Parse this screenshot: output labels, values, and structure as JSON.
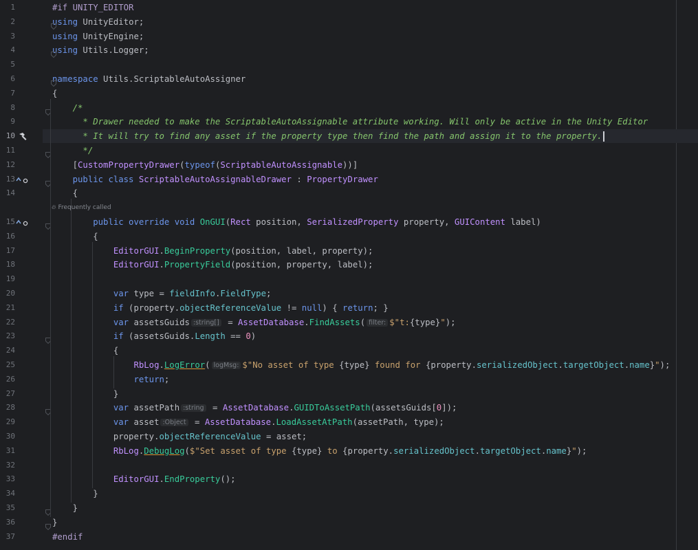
{
  "editor": {
    "code_vision_hint": "Frequently called",
    "lines": [
      {
        "n": "1",
        "parts": [
          [
            "pre",
            "#if UNITY_EDITOR"
          ]
        ]
      },
      {
        "n": "2",
        "parts": [
          [
            "kw2",
            "using"
          ],
          [
            "plain",
            " UnityEditor;"
          ]
        ]
      },
      {
        "n": "3",
        "parts": [
          [
            "kw2",
            "using"
          ],
          [
            "plain",
            " UnityEngine;"
          ]
        ]
      },
      {
        "n": "4",
        "parts": [
          [
            "kw2",
            "using"
          ],
          [
            "plain",
            " Utils.Logger;"
          ]
        ]
      },
      {
        "n": "5",
        "parts": []
      },
      {
        "n": "6",
        "parts": [
          [
            "kw2",
            "namespace"
          ],
          [
            "plain",
            " Utils.ScriptableAutoAssigner"
          ]
        ]
      },
      {
        "n": "7",
        "parts": [
          [
            "plain",
            "{"
          ]
        ]
      },
      {
        "n": "8",
        "parts": [
          [
            "plain",
            "    "
          ],
          [
            "cmt",
            "/*"
          ]
        ]
      },
      {
        "n": "9",
        "parts": [
          [
            "plain",
            "    "
          ],
          [
            "cmt",
            "  * Drawer needed to make the ScriptableAutoAssignable attribute working. Will only be active in the Unity Editor"
          ]
        ]
      },
      {
        "n": "10",
        "parts": [
          [
            "plain",
            "    "
          ],
          [
            "cmt",
            "  * It will try to find any asset if the property type then find the path and assign it to the property."
          ]
        ],
        "caret": true
      },
      {
        "n": "11",
        "parts": [
          [
            "plain",
            "    "
          ],
          [
            "cmt",
            "  */"
          ]
        ]
      },
      {
        "n": "12",
        "parts": [
          [
            "plain",
            "    ["
          ],
          [
            "cls",
            "CustomPropertyDrawer"
          ],
          [
            "plain",
            "("
          ],
          [
            "kw2",
            "typeof"
          ],
          [
            "plain",
            "("
          ],
          [
            "cls",
            "ScriptableAutoAssignable"
          ],
          [
            "plain",
            "))]"
          ]
        ]
      },
      {
        "n": "13",
        "parts": [
          [
            "plain",
            "    "
          ],
          [
            "kw2",
            "public class"
          ],
          [
            "plain",
            " "
          ],
          [
            "cls",
            "ScriptableAutoAssignableDrawer"
          ],
          [
            "plain",
            " : "
          ],
          [
            "cls",
            "PropertyDrawer"
          ]
        ]
      },
      {
        "n": "14",
        "parts": [
          [
            "plain",
            "    {"
          ]
        ]
      },
      {
        "n": "15",
        "parts": [
          [
            "plain",
            "        "
          ],
          [
            "kw2",
            "public override void"
          ],
          [
            "plain",
            " "
          ],
          [
            "fn",
            "OnGUI"
          ],
          [
            "plain",
            "("
          ],
          [
            "cls",
            "Rect"
          ],
          [
            "plain",
            " position, "
          ],
          [
            "cls",
            "SerializedProperty"
          ],
          [
            "plain",
            " property, "
          ],
          [
            "cls",
            "GUIContent"
          ],
          [
            "plain",
            " label)"
          ]
        ]
      },
      {
        "n": "16",
        "parts": [
          [
            "plain",
            "        {"
          ]
        ]
      },
      {
        "n": "17",
        "parts": [
          [
            "plain",
            "            "
          ],
          [
            "cls",
            "EditorGUI"
          ],
          [
            "plain",
            "."
          ],
          [
            "fn",
            "BeginProperty"
          ],
          [
            "plain",
            "(position, label, property);"
          ]
        ]
      },
      {
        "n": "18",
        "parts": [
          [
            "plain",
            "            "
          ],
          [
            "cls",
            "EditorGUI"
          ],
          [
            "plain",
            "."
          ],
          [
            "fn",
            "PropertyField"
          ],
          [
            "plain",
            "(position, property, label);"
          ]
        ]
      },
      {
        "n": "19",
        "parts": []
      },
      {
        "n": "20",
        "parts": [
          [
            "plain",
            "            "
          ],
          [
            "kw2",
            "var"
          ],
          [
            "plain",
            " type = "
          ],
          [
            "prop",
            "fieldInfo"
          ],
          [
            "plain",
            "."
          ],
          [
            "prop",
            "FieldType"
          ],
          [
            "plain",
            ";"
          ]
        ]
      },
      {
        "n": "21",
        "parts": [
          [
            "plain",
            "            "
          ],
          [
            "kw2",
            "if"
          ],
          [
            "plain",
            " (property."
          ],
          [
            "prop",
            "objectReferenceValue"
          ],
          [
            "plain",
            " != "
          ],
          [
            "kw2",
            "null"
          ],
          [
            "plain",
            ") { "
          ],
          [
            "kw2",
            "return"
          ],
          [
            "plain",
            "; }"
          ]
        ]
      },
      {
        "n": "22",
        "parts": [
          [
            "plain",
            "            "
          ],
          [
            "kw2",
            "var"
          ],
          [
            "plain",
            " assetsGuids"
          ],
          [
            "hint",
            ":string[]"
          ],
          [
            "plain",
            " = "
          ],
          [
            "cls",
            "AssetDatabase"
          ],
          [
            "plain",
            "."
          ],
          [
            "fn",
            "FindAssets"
          ],
          [
            "plain",
            "("
          ],
          [
            "hint",
            "filter:"
          ],
          [
            "str",
            "$\"t:"
          ],
          [
            "plain",
            "{type}"
          ],
          [
            "str",
            "\""
          ],
          [
            "plain",
            ");"
          ]
        ]
      },
      {
        "n": "23",
        "parts": [
          [
            "plain",
            "            "
          ],
          [
            "kw2",
            "if"
          ],
          [
            "plain",
            " (assetsGuids."
          ],
          [
            "prop",
            "Length"
          ],
          [
            "plain",
            " == "
          ],
          [
            "num",
            "0"
          ],
          [
            "plain",
            ")"
          ]
        ]
      },
      {
        "n": "24",
        "parts": [
          [
            "plain",
            "            {"
          ]
        ]
      },
      {
        "n": "25",
        "parts": [
          [
            "plain",
            "                "
          ],
          [
            "cls",
            "RbLog"
          ],
          [
            "plain",
            "."
          ],
          [
            "warnfn",
            "LogError"
          ],
          [
            "plain",
            "("
          ],
          [
            "hint",
            "logMsg:"
          ],
          [
            "str",
            "$\"No asset of type "
          ],
          [
            "plain",
            "{type}"
          ],
          [
            "str",
            " found for "
          ],
          [
            "plain",
            "{property."
          ],
          [
            "prop",
            "serializedObject"
          ],
          [
            "plain",
            "."
          ],
          [
            "prop",
            "targetObject"
          ],
          [
            "plain",
            "."
          ],
          [
            "prop",
            "name"
          ],
          [
            "plain",
            "}"
          ],
          [
            "str",
            "\""
          ],
          [
            "plain",
            ");"
          ]
        ]
      },
      {
        "n": "26",
        "parts": [
          [
            "plain",
            "                "
          ],
          [
            "kw2",
            "return"
          ],
          [
            "plain",
            ";"
          ]
        ]
      },
      {
        "n": "27",
        "parts": [
          [
            "plain",
            "            }"
          ]
        ]
      },
      {
        "n": "28",
        "parts": [
          [
            "plain",
            "            "
          ],
          [
            "kw2",
            "var"
          ],
          [
            "plain",
            " assetPath"
          ],
          [
            "hint",
            ":string"
          ],
          [
            "plain",
            " = "
          ],
          [
            "cls",
            "AssetDatabase"
          ],
          [
            "plain",
            "."
          ],
          [
            "fn",
            "GUIDToAssetPath"
          ],
          [
            "plain",
            "(assetsGuids["
          ],
          [
            "num",
            "0"
          ],
          [
            "plain",
            "]);"
          ]
        ]
      },
      {
        "n": "29",
        "parts": [
          [
            "plain",
            "            "
          ],
          [
            "kw2",
            "var"
          ],
          [
            "plain",
            " asset"
          ],
          [
            "hint",
            ":Object"
          ],
          [
            "plain",
            " = "
          ],
          [
            "cls",
            "AssetDatabase"
          ],
          [
            "plain",
            "."
          ],
          [
            "fn",
            "LoadAssetAtPath"
          ],
          [
            "plain",
            "(assetPath, type);"
          ]
        ]
      },
      {
        "n": "30",
        "parts": [
          [
            "plain",
            "            property."
          ],
          [
            "prop",
            "objectReferenceValue"
          ],
          [
            "plain",
            " = asset;"
          ]
        ]
      },
      {
        "n": "31",
        "parts": [
          [
            "plain",
            "            "
          ],
          [
            "cls",
            "RbLog"
          ],
          [
            "plain",
            "."
          ],
          [
            "warnfn",
            "DebugLog"
          ],
          [
            "plain",
            "("
          ],
          [
            "str",
            "$\"Set asset of type "
          ],
          [
            "plain",
            "{type}"
          ],
          [
            "str",
            " to "
          ],
          [
            "plain",
            "{property."
          ],
          [
            "prop",
            "serializedObject"
          ],
          [
            "plain",
            "."
          ],
          [
            "prop",
            "targetObject"
          ],
          [
            "plain",
            "."
          ],
          [
            "prop",
            "name"
          ],
          [
            "plain",
            "}"
          ],
          [
            "str",
            "\""
          ],
          [
            "plain",
            ");"
          ]
        ]
      },
      {
        "n": "32",
        "parts": []
      },
      {
        "n": "33",
        "parts": [
          [
            "plain",
            "            "
          ],
          [
            "cls",
            "EditorGUI"
          ],
          [
            "plain",
            "."
          ],
          [
            "fn",
            "EndProperty"
          ],
          [
            "plain",
            "();"
          ]
        ]
      },
      {
        "n": "34",
        "parts": [
          [
            "plain",
            "        }"
          ]
        ]
      },
      {
        "n": "35",
        "parts": [
          [
            "plain",
            "    }"
          ]
        ]
      },
      {
        "n": "36",
        "parts": [
          [
            "plain",
            "}"
          ]
        ]
      },
      {
        "n": "37",
        "parts": [
          [
            "pre",
            "#endif"
          ]
        ]
      }
    ]
  },
  "colors": {
    "background": "#1e1f22",
    "keyword": "#6c95eb",
    "class": "#c191ff",
    "method": "#39cc9b",
    "string": "#c9a26d",
    "comment": "#85c46c",
    "number": "#ed94c0",
    "property": "#66c3cc"
  },
  "gutter_icons": {
    "line10": "hammer-icon",
    "line13": "implemented-override-icon",
    "line15": "implemented-override-icon"
  }
}
